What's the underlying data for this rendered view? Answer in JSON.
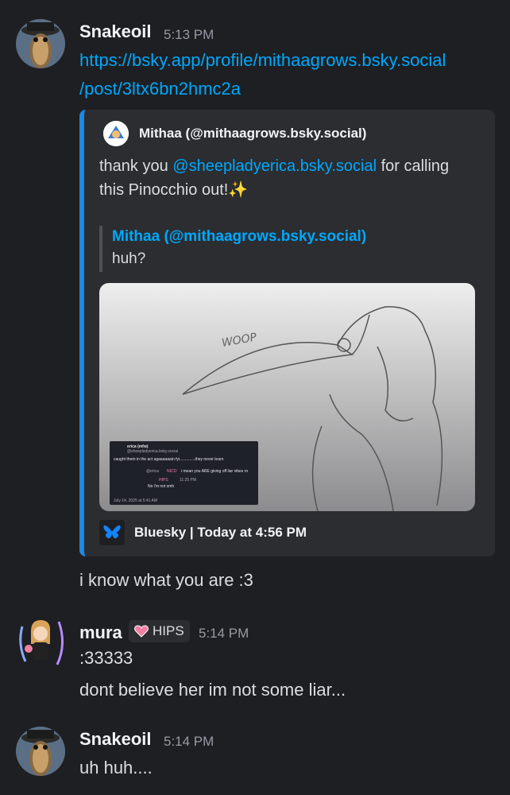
{
  "messages": [
    {
      "author": "Snakeoil",
      "time": "5:13 PM",
      "link_line1": "https://bsky.app/profile/mithaagrows.bsky.social",
      "link_line2": "/post/3ltx6bn2hmc2a",
      "embed": {
        "author": "Mithaa (@mithaagrows.bsky.social)",
        "desc_pre": "thank you ",
        "desc_mention": "@sheepladyerica.bsky.social",
        "desc_post": " for calling",
        "desc_line2": "this Pinocchio out!✨",
        "quote_title": "Mithaa (@mithaagrows.bsky.social)",
        "quote_text": "huh?",
        "image": {
          "drawing_text": "WOOP",
          "inset_name": "erica (mfw)",
          "inset_handle": "@sheepladyerica.bsky.social",
          "inset_body": "caught them in the act agaaaaaain fyi..............they never learn",
          "inset_reply_user": "@erica",
          "inset_reply_tag": "NICO",
          "inset_reply_text": "i mean you ARE giving off liar vibes rn",
          "inset_nested_tag": "HIPS",
          "inset_nested_time": "11:25 PM",
          "inset_nested_text": "No i'm not smh",
          "inset_date": "July 14, 2025 at 5:41 AM"
        },
        "footer": "Bluesky | Today at 4:56 PM"
      },
      "followup": "i know what you are :3"
    },
    {
      "author": "mura",
      "badge": "HIPS",
      "time": "5:14 PM",
      "line1": ":33333",
      "line2": "dont believe her im not some liar..."
    },
    {
      "author": "Snakeoil",
      "time": "5:14 PM",
      "line1": "uh huh...."
    }
  ],
  "colors": {
    "background": "#1e1f22",
    "embed_bg": "#2b2d31",
    "embed_border": "#1e88e5",
    "link": "#00a8fc",
    "badge_heart": "#f47fa4"
  }
}
